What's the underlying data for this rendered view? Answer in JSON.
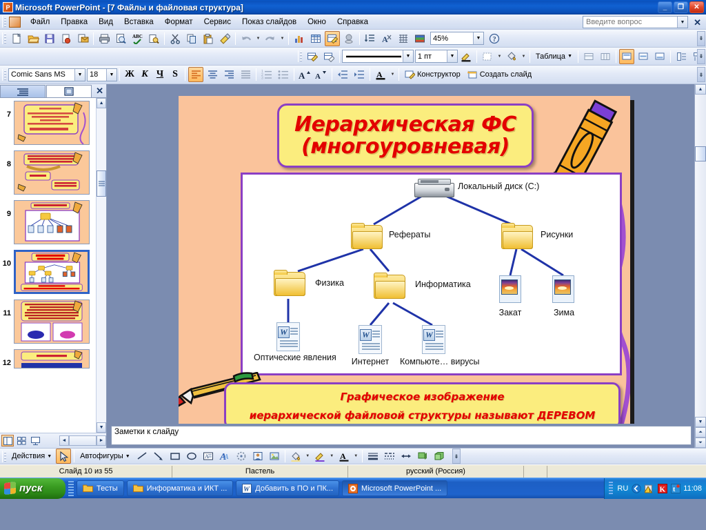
{
  "window": {
    "title": "Microsoft PowerPoint - [7 Файлы и файловая структура]",
    "app_icon": "powerpoint-icon",
    "minimize": "_",
    "restore": "❐",
    "close": "✕"
  },
  "menubar": {
    "items": [
      {
        "label": "Файл",
        "accel": "Ф"
      },
      {
        "label": "Правка",
        "accel": "П"
      },
      {
        "label": "Вид",
        "accel": "и"
      },
      {
        "label": "Вставка",
        "accel": "а"
      },
      {
        "label": "Формат",
        "accel": "м"
      },
      {
        "label": "Сервис",
        "accel": "е"
      },
      {
        "label": "Показ слайдов",
        "accel": "й"
      },
      {
        "label": "Окно",
        "accel": "О"
      },
      {
        "label": "Справка",
        "accel": "С"
      }
    ],
    "ask_placeholder": "Введите вопрос",
    "close_label": "✕"
  },
  "standard_toolbar": {
    "zoom_value": "45%",
    "buttons": [
      "new-document-icon",
      "open-folder-icon",
      "save-icon",
      "permission-icon",
      "email-icon",
      "print-icon",
      "print-preview-icon",
      "spelling-icon",
      "research-icon",
      "cut-icon",
      "copy-icon",
      "paste-icon",
      "format-painter-icon",
      "undo-icon",
      "redo-icon",
      "insert-chart-icon",
      "insert-table-icon",
      "tables-and-borders-icon",
      "insert-hyperlink-icon",
      "expand-all-icon",
      "show-formatting-icon",
      "show-grid-icon",
      "color-scheme-icon"
    ],
    "help_icon": "help-icon"
  },
  "tables_toolbar": {
    "line_width_value": "1 пт",
    "table_menu_label": "Таблица",
    "buttons": [
      "draw-table-icon",
      "eraser-icon",
      "line-style-icon",
      "border-color-icon",
      "outside-borders-icon",
      "fill-color-icon",
      "merge-cells-icon",
      "split-cells-icon",
      "align-top-icon",
      "align-center-icon",
      "align-bottom-icon",
      "distribute-rows-icon",
      "distribute-columns-icon"
    ]
  },
  "formatting_toolbar": {
    "font_name": "Comic Sans MS",
    "font_size": "18",
    "bold_label": "Ж",
    "italic_label": "К",
    "underline_label": "Ч",
    "shadow_label": "S",
    "designer_label": "Конструктор",
    "new_slide_label": "Создать слайд",
    "buttons": [
      "align-left-icon",
      "align-center-icon",
      "align-right-icon",
      "justify-icon",
      "numbered-list-icon",
      "bulleted-list-icon",
      "increase-font-icon",
      "decrease-font-icon",
      "decrease-indent-icon",
      "increase-indent-icon",
      "font-color-icon"
    ]
  },
  "slides_pane": {
    "tab_outline": "outline-tab-icon",
    "tab_slides": "slides-tab-icon",
    "close_label": "✕",
    "thumbnails": [
      {
        "number": "7",
        "selected": false
      },
      {
        "number": "8",
        "selected": false
      },
      {
        "number": "9",
        "selected": false
      },
      {
        "number": "10",
        "selected": true
      },
      {
        "number": "11",
        "selected": false
      },
      {
        "number": "12",
        "selected": false
      }
    ],
    "view_buttons": [
      "normal-view-icon",
      "slide-sorter-icon",
      "slide-show-icon"
    ]
  },
  "slide": {
    "title_line1": "Иерархическая ФС",
    "title_line2": "(многоуровневая)",
    "caption_line1": "Графическое изображение",
    "caption_line2": "иерархической файловой структуры называют ДЕРЕВОМ",
    "background_color": "#fac39b",
    "accent_border_color": "#8b3fc4",
    "title_fill_color": "#fbed7e",
    "title_text_color": "#e30000",
    "tree": {
      "root": {
        "label": "Локальный диск (C:)",
        "icon": "hard-disk-icon"
      },
      "nodes": [
        {
          "label": "Рефераты",
          "icon": "folder-icon",
          "level": 1
        },
        {
          "label": "Рисунки",
          "icon": "folder-icon",
          "level": 1
        },
        {
          "label": "Физика",
          "icon": "folder-icon",
          "level": 2
        },
        {
          "label": "Информатика",
          "icon": "folder-icon",
          "level": 2
        },
        {
          "label": "Закат",
          "icon": "image-file-icon",
          "level": 2
        },
        {
          "label": "Зима",
          "icon": "image-file-icon",
          "level": 2
        },
        {
          "label": "Оптические явления",
          "icon": "word-document-icon",
          "level": 3
        },
        {
          "label": "Интернет",
          "icon": "word-document-icon",
          "level": 3
        },
        {
          "label": "Компьюте… вирусы",
          "icon": "word-document-icon",
          "level": 3
        }
      ],
      "link_color": "#1f33a8"
    },
    "decorations": [
      "crayon-clipart",
      "pencil-clipart",
      "squiggle-line"
    ]
  },
  "notes": {
    "placeholder": "Заметки к слайду"
  },
  "drawing_toolbar": {
    "actions_label": "Действия",
    "autoshapes_label": "Автофигуры",
    "buttons": [
      "select-arrow-icon",
      "line-icon",
      "arrow-icon",
      "rectangle-icon",
      "oval-icon",
      "text-box-icon",
      "wordart-icon",
      "diagram-icon",
      "clipart-icon",
      "picture-icon",
      "fill-color-icon",
      "line-color-icon",
      "font-color-icon",
      "line-style-icon",
      "dash-style-icon",
      "arrow-style-icon",
      "shadow-style-icon",
      "3d-style-icon"
    ]
  },
  "statusbar": {
    "slide_info": "Слайд 10 из 55",
    "design_name": "Пастель",
    "language": "русский (Россия)"
  },
  "taskbar": {
    "start_label": "пуск",
    "tasks": [
      {
        "label": "Тесты",
        "icon": "folder-icon",
        "active": false
      },
      {
        "label": "Информатика и ИКТ ...",
        "icon": "folder-icon",
        "active": false
      },
      {
        "label": "Добавить в ПО и ПК...",
        "icon": "word-icon",
        "active": false
      },
      {
        "label": "Microsoft PowerPoint ...",
        "icon": "powerpoint-icon",
        "active": true
      }
    ],
    "language_indicator": "RU",
    "clock": "11:08",
    "tray_icons": [
      "messenger-icon",
      "warning-icon",
      "kaspersky-icon",
      "notes-icon"
    ]
  }
}
